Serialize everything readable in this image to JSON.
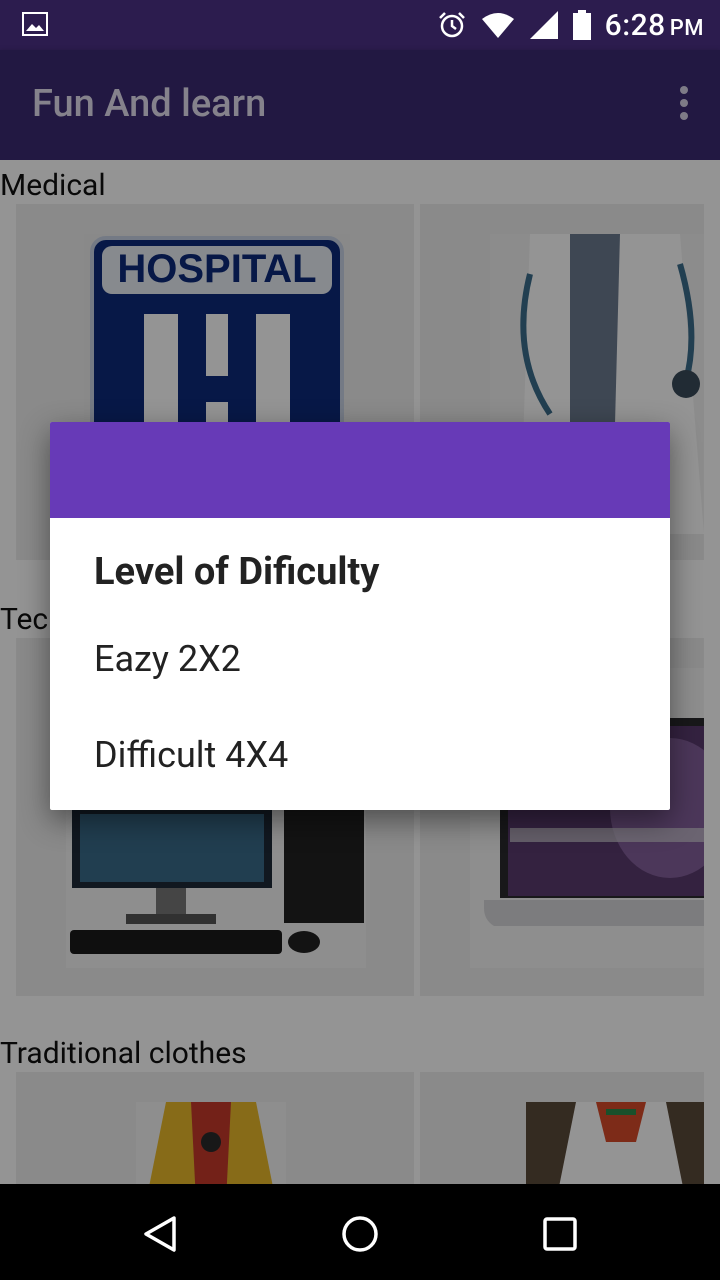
{
  "status_bar": {
    "time": "6:28",
    "ampm": "PM",
    "icons": [
      "image-icon",
      "alarm-icon",
      "wifi-icon",
      "signal-icon",
      "battery-icon"
    ]
  },
  "app_bar": {
    "title": "Fun And learn",
    "overflow_icon": "more-vert-icon"
  },
  "sections": [
    {
      "title": "Medical",
      "images": [
        "hospital sign",
        "doctor with stethoscope"
      ]
    },
    {
      "title": "Tec",
      "images": [
        "desktop computer",
        "laptop"
      ]
    },
    {
      "title": "Traditional clothes",
      "images": [
        "traditional dress",
        "traditional dress"
      ]
    }
  ],
  "dialog": {
    "title": "Level of Dificulty",
    "options": [
      "Eazy 2X2",
      "Difficult 4X4"
    ],
    "header_color": "#673ab7"
  },
  "nav_bar": {
    "buttons": [
      "back-icon",
      "home-icon",
      "recents-icon"
    ]
  },
  "colors": {
    "status_bar": "#2c1c4e",
    "app_bar": "#3b2a72",
    "accent": "#673ab7"
  }
}
